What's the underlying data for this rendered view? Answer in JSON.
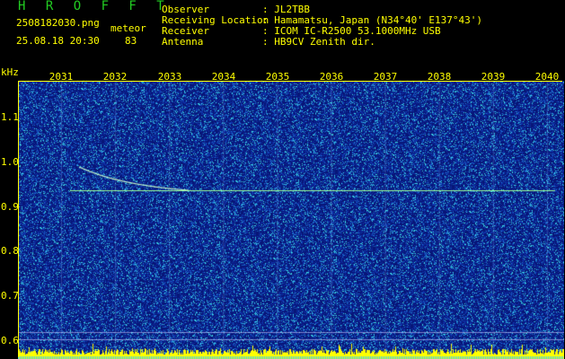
{
  "header": {
    "brand": "H R O F F T",
    "filename": "2508182030.png",
    "mode": "meteor",
    "datetime": "25.08.18 20:30",
    "count": "83",
    "fields": [
      {
        "label": "Observer",
        "value": ": JL2TBB"
      },
      {
        "label": "Receiving Location",
        "value": ": Hamamatsu, Japan (N34°40' E137°43')"
      },
      {
        "label": "Receiver",
        "value": ": ICOM IC-R2500 53.1000MHz USB"
      },
      {
        "label": "Antenna",
        "value": ": HB9CV Zenith dir."
      }
    ]
  },
  "axes": {
    "y_unit": "kHz",
    "x_ticks": [
      "2031",
      "2032",
      "2033",
      "2034",
      "2035",
      "2036",
      "2037",
      "2038",
      "2039",
      "2040"
    ],
    "y_ticks": [
      "1.1",
      "1.0",
      "0.9",
      "0.8",
      "0.7",
      "0.6"
    ]
  },
  "colors": {
    "label_yellow": "#ffff00",
    "brand_green": "#22cc22",
    "spectrum_bg": "#0a1a8a",
    "echo_line": "#99ff99",
    "noise_bars": "#ffff00"
  }
}
